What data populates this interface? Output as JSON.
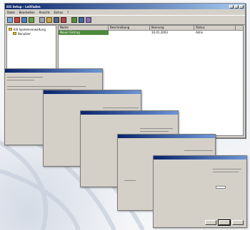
{
  "window": {
    "title": "EIS Setup - Leitfaden",
    "menu": [
      "Datei",
      "Bearbeiten",
      "Ansicht",
      "Extras",
      "?"
    ]
  },
  "tree": {
    "items": [
      {
        "label": "EIS Systemverwaltung",
        "level": 0
      },
      {
        "label": "Benutzer",
        "level": 1
      }
    ]
  },
  "list": {
    "columns": [
      "Name",
      "Beschreibung",
      "Kennung",
      "Status"
    ],
    "rows": [
      {
        "cells": [
          "Neuer Eintrag",
          "",
          "10.01.2003",
          "Aktiv"
        ]
      }
    ]
  },
  "dialogs": {
    "count": 5
  },
  "colors": {
    "titlebar": "#0a246a",
    "selection": "#4a8a3a",
    "face": "#d4d0c8"
  }
}
